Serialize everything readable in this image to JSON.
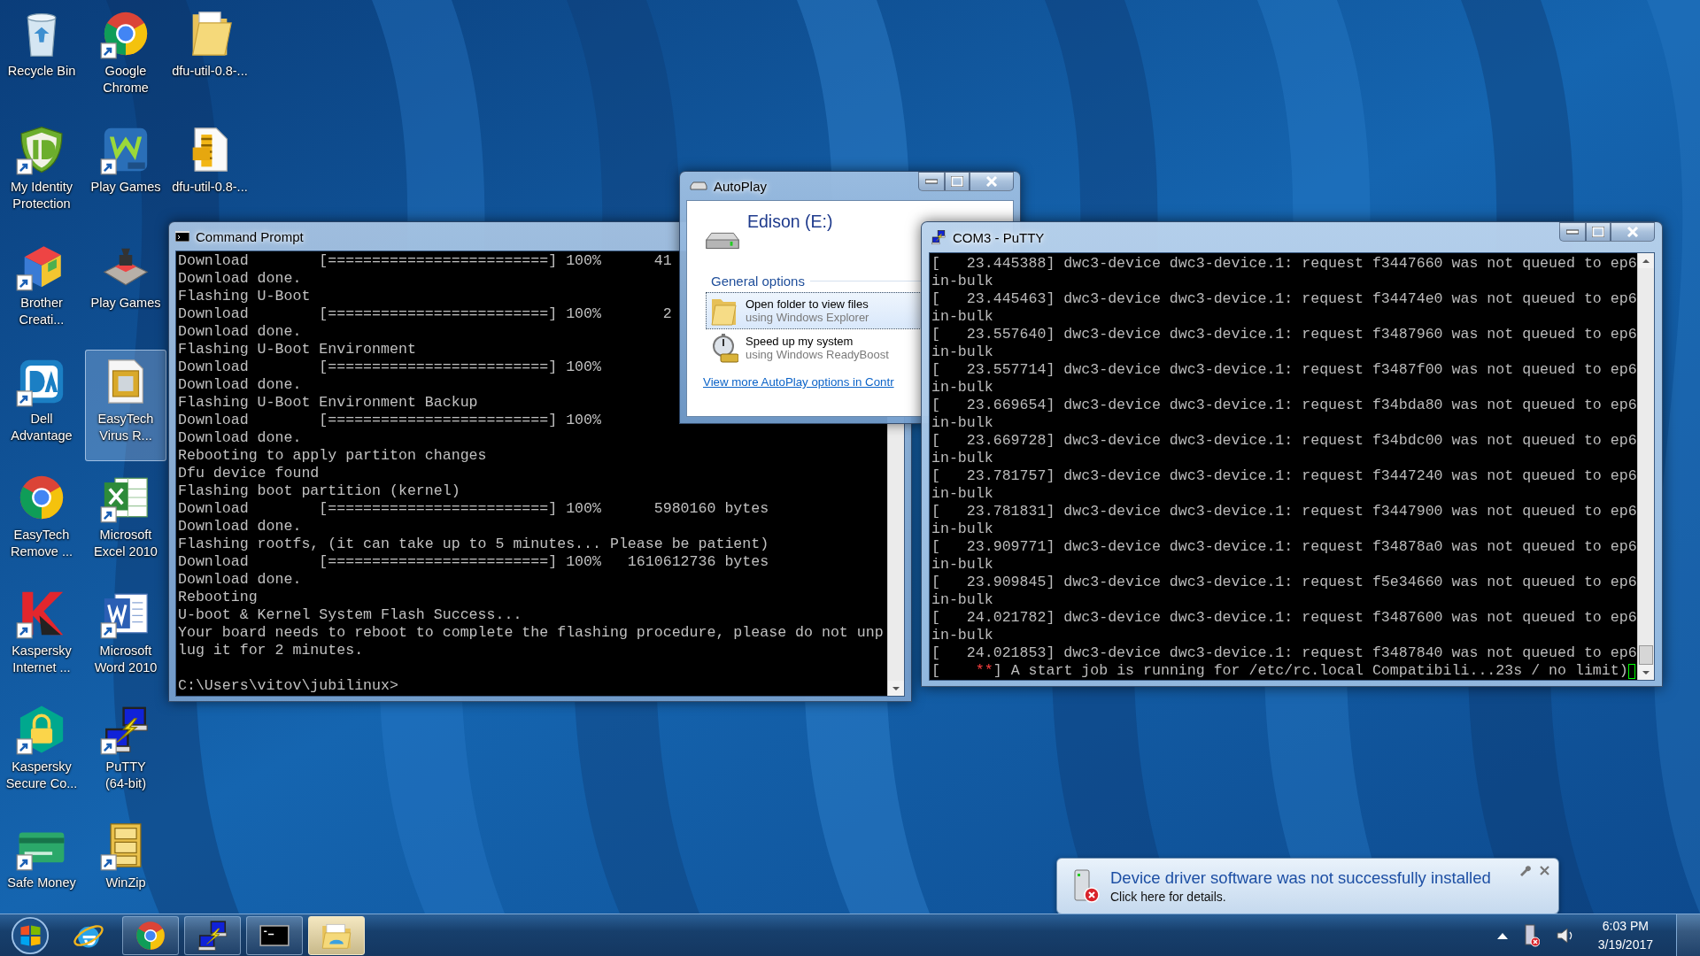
{
  "desktop_icons": [
    {
      "label": "Recycle Bin",
      "kind": "recycle",
      "shortcut": false,
      "selected": false
    },
    {
      "label": "My Identity Protection",
      "kind": "shield",
      "shortcut": true,
      "selected": false
    },
    {
      "label": "Brother Creati...",
      "kind": "cube",
      "shortcut": true,
      "selected": false
    },
    {
      "label": "Dell Advantage",
      "kind": "tile",
      "shortcut": true,
      "selected": false
    },
    {
      "label": "EasyTech Remove ...",
      "kind": "browser",
      "shortcut": false,
      "selected": false
    },
    {
      "label": "Kaspersky Internet ...",
      "kind": "angle",
      "shortcut": true,
      "selected": false
    },
    {
      "label": "Kaspersky Secure Co...",
      "kind": "lock",
      "shortcut": true,
      "selected": false
    },
    {
      "label": "Safe Money",
      "kind": "card",
      "shortcut": true,
      "selected": false
    },
    {
      "label": "Google Chrome",
      "kind": "browser",
      "shortcut": true,
      "selected": false
    },
    {
      "label": "Play Games",
      "kind": "games",
      "shortcut": true,
      "selected": false
    },
    {
      "label": "Play Games",
      "kind": "chess",
      "shortcut": false,
      "selected": false
    },
    {
      "label": "EasyTech Virus R...",
      "kind": "frame",
      "shortcut": false,
      "selected": true
    },
    {
      "label": "Microsoft Excel 2010",
      "kind": "sheet",
      "shortcut": true,
      "selected": false
    },
    {
      "label": "Microsoft Word 2010",
      "kind": "doc",
      "shortcut": true,
      "selected": false
    },
    {
      "label": "PuTTY (64-bit)",
      "kind": "computers",
      "shortcut": true,
      "selected": false
    },
    {
      "label": "WinZip",
      "kind": "cabinet",
      "shortcut": true,
      "selected": false
    },
    {
      "label": "dfu-util-0.8-...",
      "kind": "folder",
      "shortcut": false,
      "selected": false
    },
    {
      "label": "dfu-util-0.8-...",
      "kind": "zip",
      "shortcut": false,
      "selected": false
    }
  ],
  "command_prompt": {
    "title": "Command Prompt",
    "lines": [
      "Download        [=========================] 100%      41",
      "Download done.",
      "Flashing U-Boot",
      "Download        [=========================] 100%       2",
      "Download done.",
      "Flashing U-Boot Environment",
      "Download        [=========================] 100%",
      "Download done.",
      "Flashing U-Boot Environment Backup",
      "Download        [=========================] 100%",
      "Download done.",
      "Rebooting to apply partiton changes",
      "Dfu device found",
      "Flashing boot partition (kernel)",
      "Download        [=========================] 100%      5980160 bytes",
      "Download done.",
      "Flashing rootfs, (it can take up to 5 minutes... Please be patient)",
      "Download        [=========================] 100%   1610612736 bytes",
      "Download done.",
      "Rebooting",
      "U-boot & Kernel System Flash Success...",
      "Your board needs to reboot to complete the flashing procedure, please do not unp",
      "lug it for 2 minutes."
    ],
    "prompt": "C:\\Users\\vitov\\jubilinux>"
  },
  "autoplay": {
    "title": "AutoPlay",
    "drive": "Edison (E:)",
    "section": "General options",
    "options": [
      {
        "title": "Open folder to view files",
        "subtitle": "using Windows Explorer",
        "kind": "folder",
        "selected": true
      },
      {
        "title": "Speed up my system",
        "subtitle": "using Windows ReadyBoost",
        "kind": "readyboost",
        "selected": false
      }
    ],
    "link": "View more AutoPlay options in Contr"
  },
  "putty": {
    "title": "COM3 - PuTTY",
    "lines": [
      "[   23.445388] dwc3-device dwc3-device.1: request f3447660 was not queued to ep6",
      "in-bulk",
      "[   23.445463] dwc3-device dwc3-device.1: request f34474e0 was not queued to ep6",
      "in-bulk",
      "[   23.557640] dwc3-device dwc3-device.1: request f3487960 was not queued to ep6",
      "in-bulk",
      "[   23.557714] dwc3-device dwc3-device.1: request f3487f00 was not queued to ep6",
      "in-bulk",
      "[   23.669654] dwc3-device dwc3-device.1: request f34bda80 was not queued to ep6",
      "in-bulk",
      "[   23.669728] dwc3-device dwc3-device.1: request f34bdc00 was not queued to ep6",
      "in-bulk",
      "[   23.781757] dwc3-device dwc3-device.1: request f3447240 was not queued to ep6",
      "in-bulk",
      "[   23.781831] dwc3-device dwc3-device.1: request f3447900 was not queued to ep6",
      "in-bulk",
      "[   23.909771] dwc3-device dwc3-device.1: request f34878a0 was not queued to ep6",
      "in-bulk",
      "[   23.909845] dwc3-device dwc3-device.1: request f5e34660 was not queued to ep6",
      "in-bulk",
      "[   24.021782] dwc3-device dwc3-device.1: request f3487600 was not queued to ep6",
      "in-bulk",
      "[   24.021853] dwc3-device dwc3-device.1: request f3487840 was not queued to ep6"
    ],
    "status_line": [
      {
        "text": "[    ",
        "color": "#bbbbbb"
      },
      {
        "text": "**",
        "color": "#ff4040"
      },
      {
        "text": "] A start job is running for /etc/rc.local Compatibili...23s / no limit)",
        "color": "#bbbbbb"
      }
    ]
  },
  "notification": {
    "title": "Device driver software was not successfully installed",
    "text": "Click here for details."
  },
  "taskbar": {
    "buttons": [
      {
        "kind": "start",
        "running": false,
        "selected": false
      },
      {
        "kind": "ie",
        "running": false,
        "selected": false
      },
      {
        "kind": "browser",
        "running": true,
        "selected": false
      },
      {
        "kind": "computers",
        "running": true,
        "selected": false
      },
      {
        "kind": "terminal",
        "running": true,
        "selected": false
      },
      {
        "kind": "explorer",
        "running": true,
        "selected": true
      }
    ],
    "clock": {
      "time": "6:03 PM",
      "date": "3/19/2017"
    }
  }
}
